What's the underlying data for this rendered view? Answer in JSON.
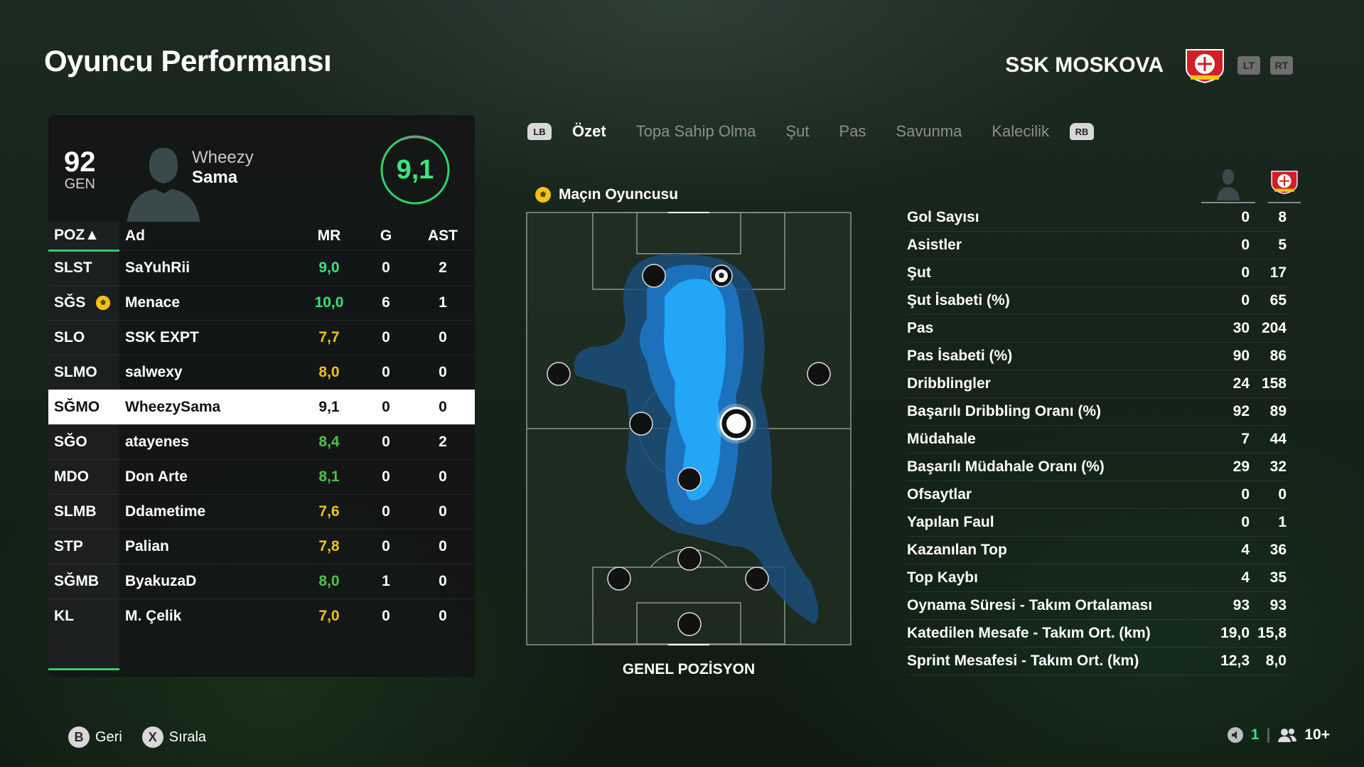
{
  "page": {
    "title": "Oyuncu Performansı"
  },
  "team": {
    "name": "SSK MOSKOVA",
    "crest_icon": "bayer-leverkusen-crest",
    "lt_label": "LT",
    "rt_label": "RT"
  },
  "player": {
    "overall": "92",
    "overall_label": "GEN",
    "first_name": "Wheezy",
    "last_name": "Sama",
    "rating": "9,1"
  },
  "roster": {
    "headers": {
      "pos": "POZ▲",
      "name": "Ad",
      "mr": "MR",
      "g": "G",
      "ast": "AST"
    },
    "rows": [
      {
        "pos": "SLST",
        "name": "SaYuhRii",
        "mr": "9,0",
        "g": "0",
        "ast": "2",
        "mr_color": "#36e37a"
      },
      {
        "pos": "SĞS",
        "name": "Menace",
        "mr": "10,0",
        "g": "6",
        "ast": "1",
        "mr_color": "#36e37a",
        "motm": true
      },
      {
        "pos": "SLO",
        "name": "SSK EXPT",
        "mr": "7,7",
        "g": "0",
        "ast": "0",
        "mr_color": "#f2c21a"
      },
      {
        "pos": "SLMO",
        "name": "salwexy",
        "mr": "8,0",
        "g": "0",
        "ast": "0",
        "mr_color": "#f2c21a"
      },
      {
        "pos": "SĞMO",
        "name": "WheezySama",
        "mr": "9,1",
        "g": "0",
        "ast": "0",
        "mr_color": "#111111",
        "selected": true
      },
      {
        "pos": "SĞO",
        "name": "atayenes",
        "mr": "8,4",
        "g": "0",
        "ast": "2",
        "mr_color": "#4cc24c"
      },
      {
        "pos": "MDO",
        "name": "Don Arte",
        "mr": "8,1",
        "g": "0",
        "ast": "0",
        "mr_color": "#4cc24c"
      },
      {
        "pos": "SLMB",
        "name": "Ddametime",
        "mr": "7,6",
        "g": "0",
        "ast": "0",
        "mr_color": "#f2c21a"
      },
      {
        "pos": "STP",
        "name": "Palian",
        "mr": "7,8",
        "g": "0",
        "ast": "0",
        "mr_color": "#f2c21a"
      },
      {
        "pos": "SĞMB",
        "name": "ByakuzaD",
        "mr": "8,0",
        "g": "1",
        "ast": "0",
        "mr_color": "#4cc24c"
      },
      {
        "pos": "KL",
        "name": "M. Çelik",
        "mr": "7,0",
        "g": "0",
        "ast": "0",
        "mr_color": "#f2c21a"
      }
    ]
  },
  "tabs": {
    "lb": "LB",
    "rb": "RB",
    "items": [
      "Özet",
      "Topa Sahip Olma",
      "Şut",
      "Pas",
      "Savunma",
      "Kalecilik"
    ],
    "active": 0
  },
  "pitch": {
    "motm_label": "Maçın Oyuncusu",
    "position_label": "GENEL POZİSYON"
  },
  "stats": [
    {
      "label": "Gol Sayısı",
      "player": "0",
      "team": "8"
    },
    {
      "label": "Asistler",
      "player": "0",
      "team": "5"
    },
    {
      "label": "Şut",
      "player": "0",
      "team": "17"
    },
    {
      "label": "Şut İsabeti (%)",
      "player": "0",
      "team": "65"
    },
    {
      "label": "Pas",
      "player": "30",
      "team": "204"
    },
    {
      "label": "Pas İsabeti (%)",
      "player": "90",
      "team": "86"
    },
    {
      "label": "Dribblingler",
      "player": "24",
      "team": "158"
    },
    {
      "label": "Başarılı Dribbling Oranı (%)",
      "player": "92",
      "team": "89"
    },
    {
      "label": "Müdahale",
      "player": "7",
      "team": "44"
    },
    {
      "label": "Başarılı Müdahale Oranı (%)",
      "player": "29",
      "team": "32"
    },
    {
      "label": "Ofsaytlar",
      "player": "0",
      "team": "0"
    },
    {
      "label": "Yapılan Faul",
      "player": "0",
      "team": "1"
    },
    {
      "label": "Kazanılan Top",
      "player": "4",
      "team": "36"
    },
    {
      "label": "Top Kaybı",
      "player": "4",
      "team": "35"
    },
    {
      "label": "Oynama Süresi - Takım Ortalaması",
      "player": "93",
      "team": "93"
    },
    {
      "label": "Katedilen Mesafe - Takım Ort. (km)",
      "player": "19,0",
      "team": "15,8"
    },
    {
      "label": "Sprint Mesafesi - Takım Ort. (km)",
      "player": "12,3",
      "team": "8,0"
    }
  ],
  "footer": {
    "back_glyph": "B",
    "back_label": "Geri",
    "sort_glyph": "X",
    "sort_label": "Sırala",
    "count": "1",
    "players": "10+"
  },
  "colors": {
    "accent": "#2fd168",
    "heatmap": "#1aa3ff"
  }
}
